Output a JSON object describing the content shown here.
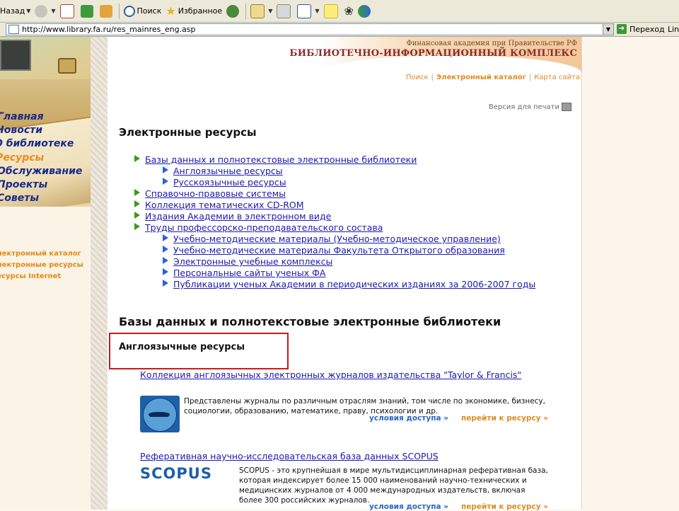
{
  "toolbar": {
    "back_label": "Назад",
    "search_label": "Поиск",
    "favorites_label": "Избранное"
  },
  "address": {
    "url": "http://www.library.fa.ru/res_mainres_eng.asp",
    "go_label": "Переход",
    "links_label": "Lin"
  },
  "left_menu": {
    "items": [
      "Главная",
      "Новости",
      "О библиотеке",
      "Ресурсы",
      "Обслуживание",
      "Проекты",
      "Советы"
    ],
    "active_index": 3,
    "quick_links": [
      "Электронный каталог",
      "Электронные ресурсы",
      "Ресурсы Internet"
    ]
  },
  "header": {
    "academy": "Финансовая академия при Правительстве РФ",
    "complex": "БИБЛИОТЕЧНО-ИНФОРМАЦИОННЫЙ КОМПЛЕКС",
    "nav": [
      "Поиск",
      "Электронный каталог",
      "Карта сайта"
    ],
    "print_label": "Версия для печати"
  },
  "page": {
    "title": "Электронные ресурсы",
    "tree": [
      {
        "level": 1,
        "label": "Базы данных и полнотекстовые электронные библиотеки"
      },
      {
        "level": 2,
        "label": "Англоязычные ресурсы"
      },
      {
        "level": 2,
        "label": "Русскоязычные ресурсы"
      },
      {
        "level": 1,
        "label": "Справочно-правовые системы"
      },
      {
        "level": 1,
        "label": "Коллекция тематических CD-ROM"
      },
      {
        "level": 1,
        "label": "Издания Академии в электронном виде"
      },
      {
        "level": 1,
        "label": "Труды профессорско-преподавательского состава"
      },
      {
        "level": 2,
        "label": "Учебно-методические материалы (Учебно-методическое управление)"
      },
      {
        "level": 2,
        "label": "Учебно-методические материалы Факультета Открытого образования"
      },
      {
        "level": 2,
        "label": "Электронные учебные комплексы"
      },
      {
        "level": 2,
        "label": "Персональные сайты ученых ФА"
      },
      {
        "level": 2,
        "label": "Публикации ученых Академии в периодических изданиях за 2006-2007 годы"
      }
    ],
    "section_title": "Базы данных и полнотекстовые электронные библиотеки",
    "subsection_title": "Англоязычные ресурсы",
    "resources": [
      {
        "title": "Коллекция англоязычных электронных журналов издательства \"Taylor & Francis\"",
        "description": "Представлены журналы по различным отраслям знаний, том числе по экономике, бизнесу, социологии, образованию, математике, праву, психологии и др.",
        "access_label": "условия доступа »",
        "go_label": "перейти к ресурсу »"
      },
      {
        "title": "Реферативная научно-исследовательская база данных SCOPUS",
        "logo_text": "SCOPUS",
        "description": "SCOPUS - это крупнейшая в мире мультидисциплинарная реферативная база, которая индексирует более 15 000 наименований научно-технических и медицинских журналов от 4 000 международных издательств, включая более 300 российских журналов.",
        "access_label": "условия доступа »",
        "go_label": "перейти к ресурсу »"
      }
    ]
  }
}
